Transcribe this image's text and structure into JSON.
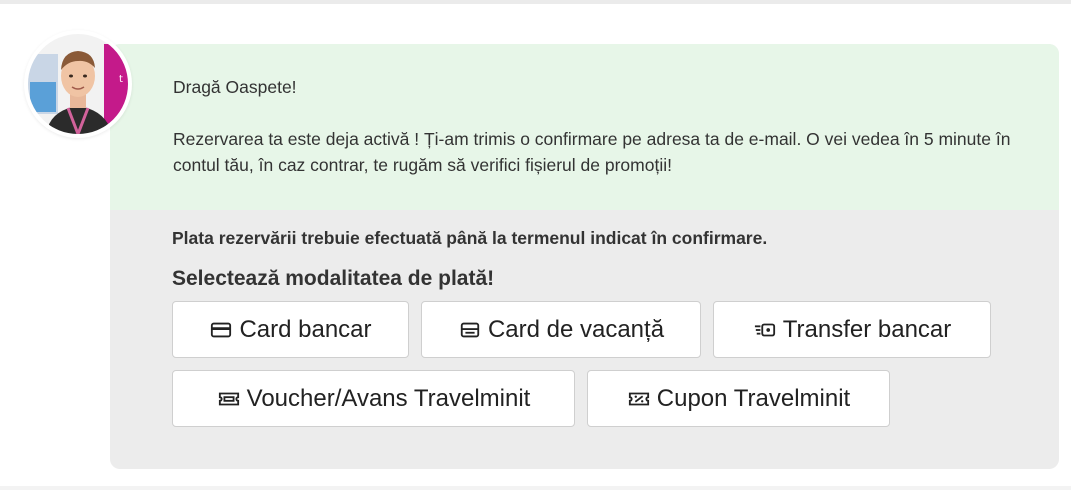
{
  "message": {
    "greeting": "Dragă Oaspete!",
    "body": "Rezervarea ta este deja activă ! Ți-am trimis o confirmare pe adresa ta de e-mail. O vei vedea în 5 minute în contul tău, în caz contrar, te rugăm să verifici fișierul de promoții!"
  },
  "payment": {
    "deadline_note": "Plata rezervării trebuie efectuată până la termenul indicat în confirmare.",
    "select_title": "Selectează modalitatea de plată!",
    "options": [
      {
        "label": "Card bancar",
        "icon": "credit-card-icon"
      },
      {
        "label": "Card de vacanță",
        "icon": "holiday-card-icon"
      },
      {
        "label": "Transfer bancar",
        "icon": "bank-transfer-icon"
      },
      {
        "label": "Voucher/Avans Travelminit",
        "icon": "voucher-ticket-icon"
      },
      {
        "label": "Cupon Travelminit",
        "icon": "coupon-percent-icon"
      }
    ]
  },
  "colors": {
    "message_background": "#e7f6e8",
    "panel_background": "#ececec",
    "button_border": "#cfcfcf"
  }
}
